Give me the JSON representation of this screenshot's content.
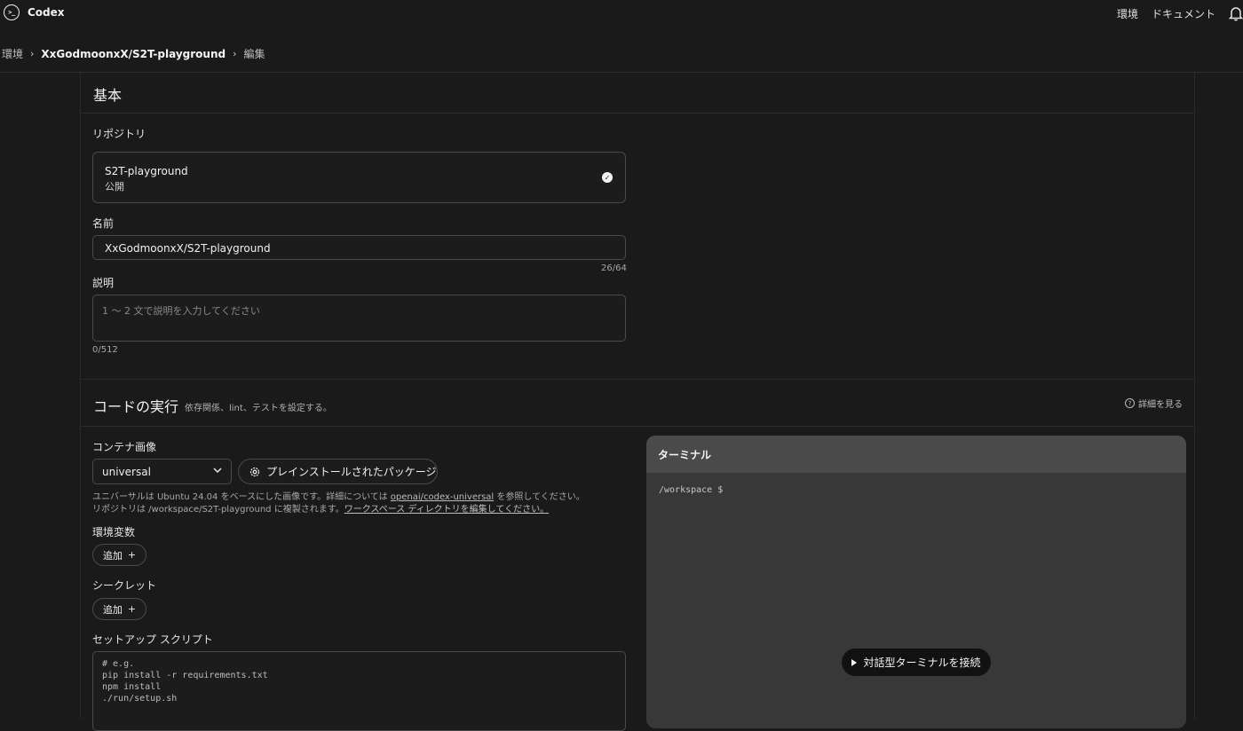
{
  "app": {
    "title": "Codex",
    "logo_glyph": ">_"
  },
  "top_nav": {
    "environments": "環境",
    "docs": "ドキュメント"
  },
  "breadcrumb": {
    "root": "環境",
    "repo": "XxGodmoonxX/S2T-playground",
    "current": "編集",
    "sep": "›"
  },
  "basic": {
    "title": "基本",
    "repository_label": "リポジトリ",
    "repository": {
      "name": "S2T-playground",
      "visibility": "公開"
    },
    "name_label": "名前",
    "name_value": "XxGodmoonxX/S2T-playground",
    "name_count": "26/64",
    "desc_label": "説明",
    "desc_placeholder": "1 〜 2 文で説明を入力してください",
    "desc_count": "0/512"
  },
  "code_exec": {
    "title": "コードの実行",
    "subtitle": "依存関係、lint、テストを設定する。",
    "learn_more": "詳細を見る",
    "container_label": "コンテナ画像",
    "container_value": "universal",
    "preinstalled_button": "プレインストールされたパッケージ",
    "help_line1_a": "ユニバーサルは Ubuntu 24.04 をベースにした画像です。詳細については ",
    "help_line1_link": "openai/codex-universal",
    "help_line1_b": " を参照してください。",
    "help_line2_a": "リポジトリは /workspace/S2T-playground に複製されます。",
    "help_line2_link": "ワークスペース ディレクトリを編集してください。",
    "env_label": "環境変数",
    "env_add": "追加",
    "secrets_label": "シークレット",
    "secrets_add": "追加",
    "setup_label": "セットアップ スクリプト",
    "setup_lines": [
      "# e.g.",
      "pip install -r requirements.txt",
      "npm install",
      "./run/setup.sh"
    ]
  },
  "terminal": {
    "title": "ターミナル",
    "prompt": "/workspace $",
    "connect_button": "対話型ターミナルを接続"
  }
}
